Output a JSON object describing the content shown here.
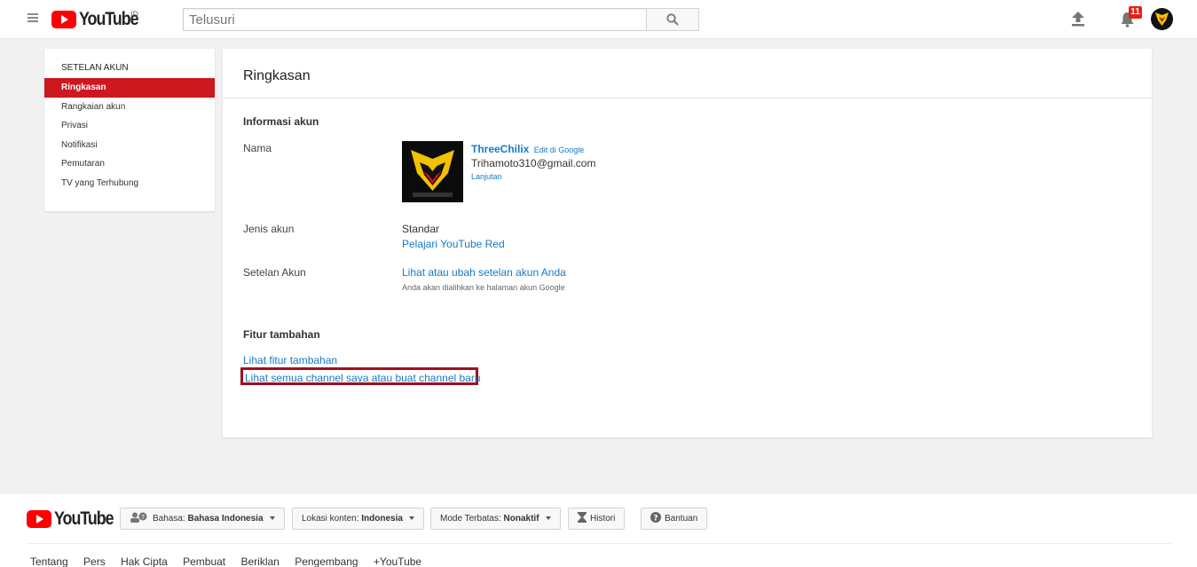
{
  "header": {
    "logo_text": "YouTube",
    "country": "ID",
    "search_placeholder": "Telusuri",
    "notification_count": "11"
  },
  "sidebar": {
    "title": "SETELAN AKUN",
    "items": [
      {
        "label": "Ringkasan",
        "active": true
      },
      {
        "label": "Rangkaian akun"
      },
      {
        "label": "Privasi"
      },
      {
        "label": "Notifikasi"
      },
      {
        "label": "Pemutaran"
      },
      {
        "label": "TV yang Terhubung"
      }
    ]
  },
  "main": {
    "title": "Ringkasan",
    "account_info": {
      "heading": "Informasi akun",
      "name_label": "Nama",
      "channel_name": "ThreeChilix",
      "edit_link": "Edit di Google",
      "email": "Trihamoto310@gmail.com",
      "advanced_link": "Lanjutan",
      "account_type_label": "Jenis akun",
      "account_type": "Standar",
      "red_link": "Pelajari YouTube Red",
      "settings_label": "Setelan Akun",
      "settings_link": "Lihat atau ubah setelan akun Anda",
      "settings_note": "Anda akan dialihkan ke halaman akun Google"
    },
    "extra": {
      "heading": "Fitur tambahan",
      "link1": "Lihat fitur tambahan",
      "link2": "Lihat semua channel saya atau buat channel baru"
    }
  },
  "footer": {
    "logo_text": "YouTube",
    "language_label": "Bahasa:",
    "language_value": "Bahasa Indonesia",
    "location_label": "Lokasi konten:",
    "location_value": "Indonesia",
    "restricted_label": "Mode Terbatas:",
    "restricted_value": "Nonaktif",
    "history": "Histori",
    "help": "Bantuan",
    "links": [
      "Tentang",
      "Pers",
      "Hak Cipta",
      "Pembuat",
      "Beriklan",
      "Pengembang",
      "+YouTube"
    ]
  },
  "colors": {
    "brand_red": "#ff0000",
    "active_red": "#cc181e",
    "link_blue": "#167ac6",
    "highlight": "#a0101f"
  }
}
